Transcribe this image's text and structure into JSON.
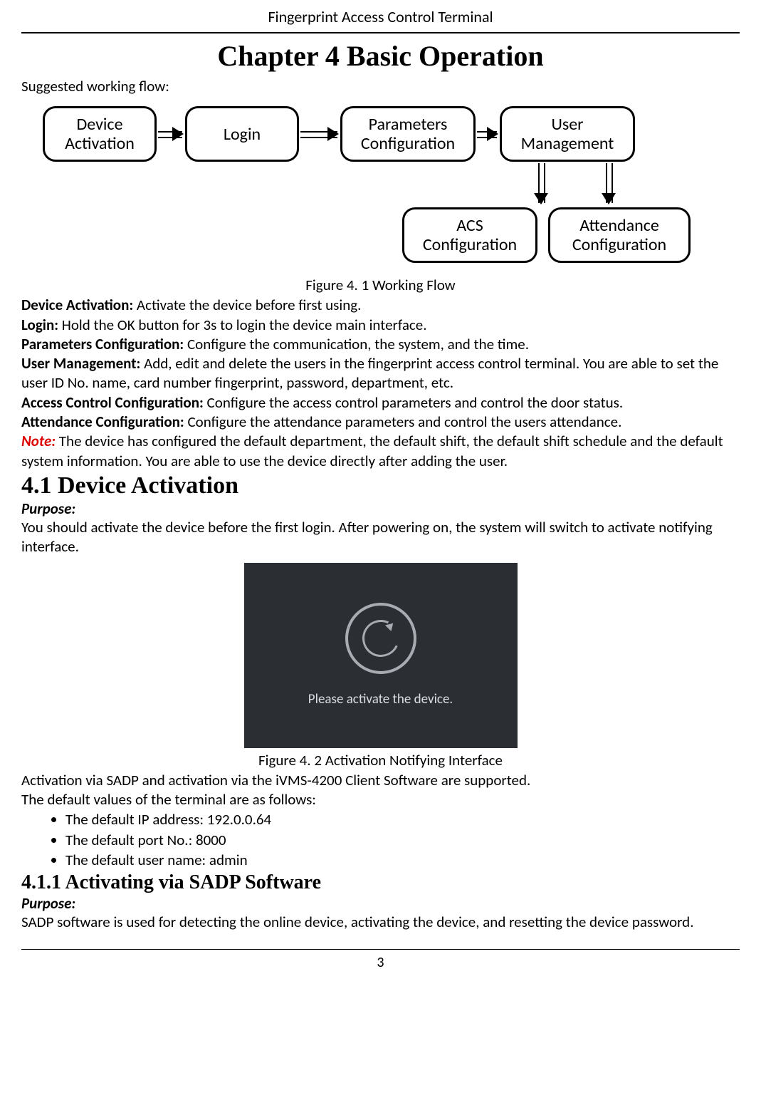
{
  "header": "Fingerprint Access Control Terminal",
  "chapter_title": "Chapter 4   Basic Operation",
  "intro": "Suggested working flow:",
  "flow_boxes": {
    "b1": "Device\nActivation",
    "b2": "Login",
    "b3": "Parameters\nConfiguration",
    "b4": "User\nManagement",
    "b5": "ACS\nConfiguration",
    "b6": "Attendance\nConfiguration"
  },
  "figure1_caption": "Figure 4. 1 Working Flow",
  "definitions": [
    {
      "term": "Device Activation:",
      "text": " Activate the device before first using."
    },
    {
      "term": "Login:",
      "text": " Hold the OK button for 3s to login the device main interface."
    },
    {
      "term": "Parameters Configuration:",
      "text": " Configure the communication, the system, and the time."
    },
    {
      "term": "User Management:",
      "text": " Add, edit and delete the users in the fingerprint access control terminal. You are able to set the user ID No. name, card number fingerprint, password, department, etc."
    },
    {
      "term": "Access Control Configuration:",
      "text": " Configure the access control parameters and control the door status."
    },
    {
      "term": "Attendance Configuration:",
      "text": " Configure the attendance parameters and control the users attendance."
    }
  ],
  "note_label": "Note:",
  "note_text": " The device has configured the default department, the default shift, the default shift schedule and the default system information. You are able to use the device directly after adding the user.",
  "section_4_1": "4.1 Device Activation",
  "purpose_label": "Purpose:",
  "purpose_4_1": "You should activate the device before the first login. After powering on, the system will switch to activate notifying interface.",
  "device_msg": "Please activate the device.",
  "figure2_caption": "Figure 4. 2 Activation Notifying Interface",
  "activation_p1": "Activation via SADP and activation via the iVMS-4200 Client Software are supported.",
  "activation_p2": "The default values of the terminal are as follows:",
  "defaults": [
    "The default IP address: 192.0.0.64",
    "The default port No.: 8000",
    "The default user name: admin"
  ],
  "section_4_1_1": "4.1.1   Activating via SADP Software",
  "purpose_4_1_1": "SADP software is used for detecting the online device, activating the device, and resetting the device password.",
  "page_number": "3"
}
